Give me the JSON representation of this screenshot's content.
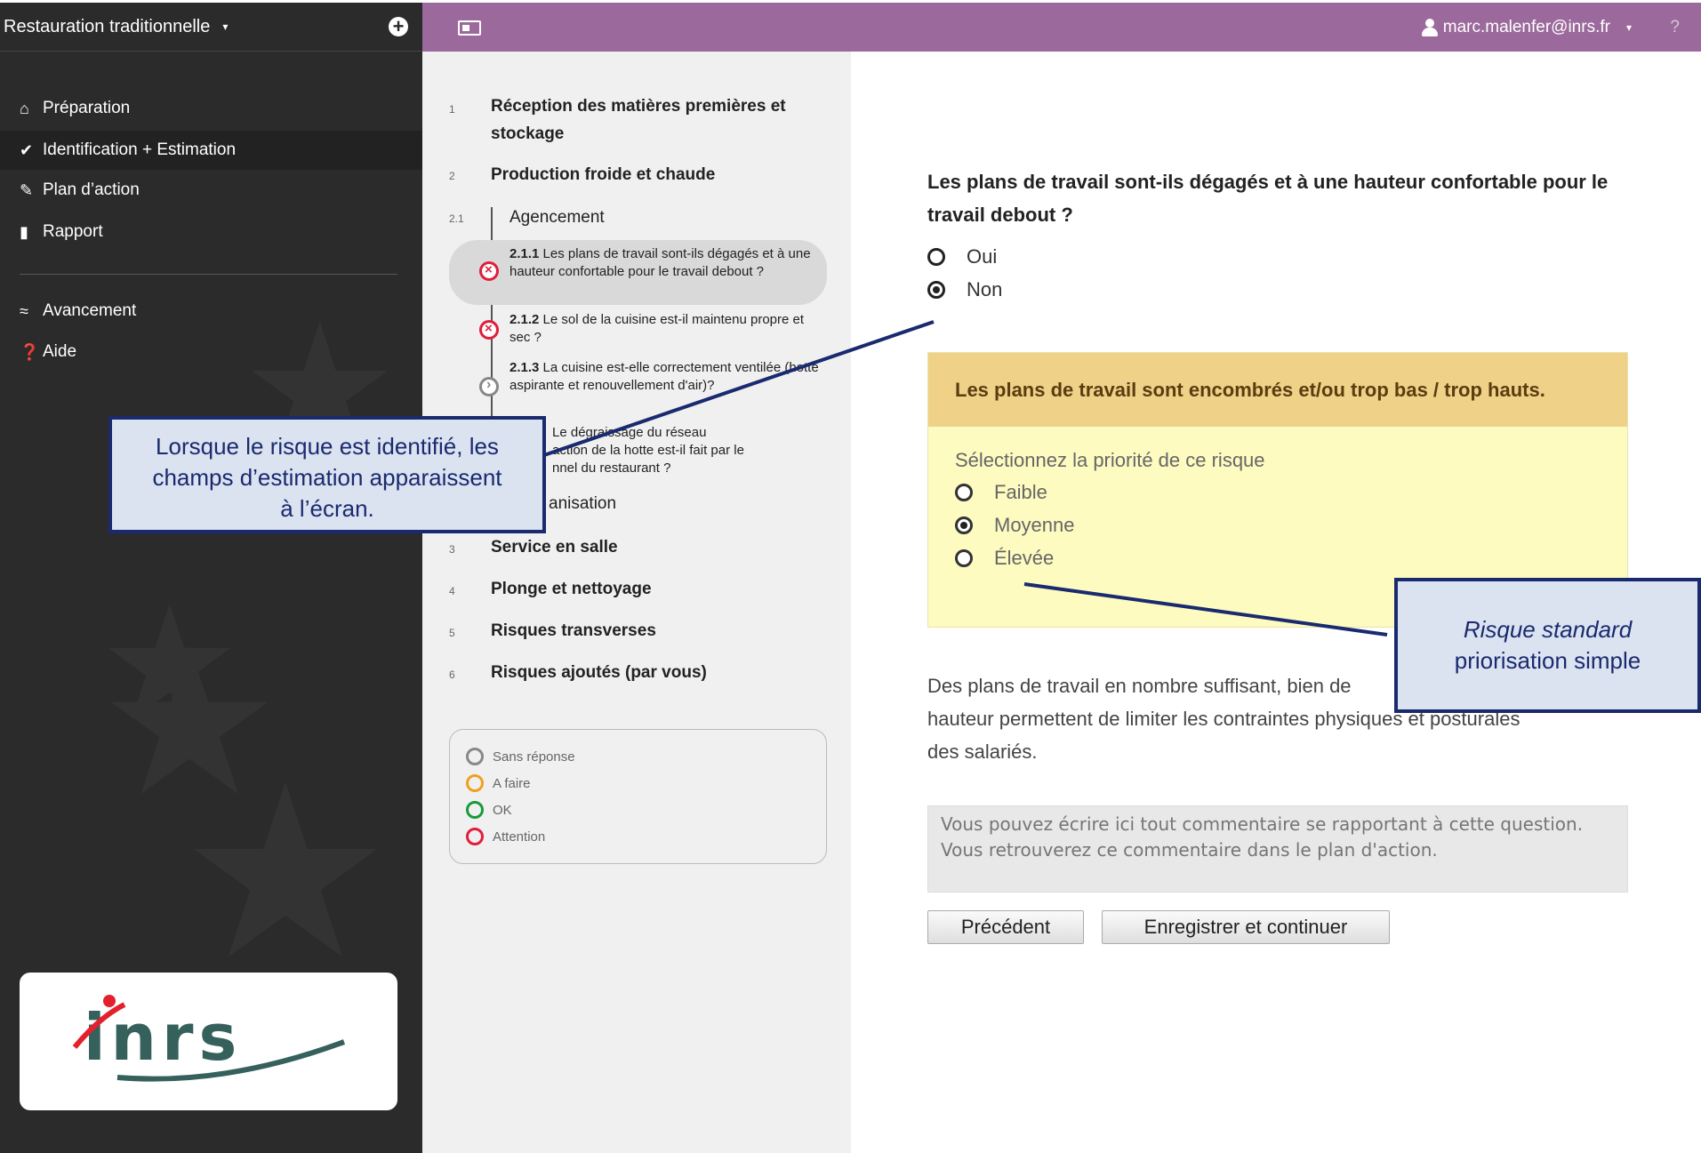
{
  "topbar": {
    "workspace_title": "Restauration traditionnelle",
    "workspace_caret": "▾",
    "add_label": "+",
    "user_email": "marc.malenfer@inrs.fr",
    "user_caret": "▾",
    "help_label": "?"
  },
  "sidebar": {
    "items": [
      {
        "label": "Préparation",
        "icon": "home-icon"
      },
      {
        "label": "Identification + Estimation",
        "icon": "check-circle-icon"
      },
      {
        "label": "Plan d’action",
        "icon": "pencil-icon"
      },
      {
        "label": "Rapport",
        "icon": "file-icon"
      },
      {
        "label": "Avancement",
        "icon": "chart-line-icon"
      },
      {
        "label": "Aide",
        "icon": "question-circle-icon"
      }
    ],
    "logo_text": "inrs"
  },
  "tree": {
    "sections": [
      {
        "num": "1",
        "label": "Réception des matières premières et stockage"
      },
      {
        "num": "2",
        "label": "Production froide et chaude"
      },
      {
        "num": "3",
        "label": "Service en salle"
      },
      {
        "num": "4",
        "label": "Plonge et nettoyage"
      },
      {
        "num": "5",
        "label": "Risques transverses"
      },
      {
        "num": "6",
        "label": "Risques ajoutés (par vous)"
      }
    ],
    "subsection": {
      "num": "2.1",
      "label": "Agencement"
    },
    "subsection2_label": "anisation",
    "questions": [
      {
        "code": "2.1.1",
        "text": "Les plans de travail sont-ils dégagés et à une hauteur confortable pour le travail debout ?"
      },
      {
        "code": "2.1.2",
        "text": "Le sol de la cuisine est-il maintenu propre et sec ?"
      },
      {
        "code": "2.1.3",
        "text": "La cuisine est-elle correctement ventilée (hotte aspirante et renouvellement d'air)?"
      },
      {
        "code": "",
        "text": "Le dégraissage du réseau"
      },
      {
        "code": "",
        "text": "action de la hotte est-il fait par le"
      },
      {
        "code": "",
        "text": "nnel du restaurant ?"
      }
    ],
    "legend": [
      {
        "label": "Sans réponse",
        "color": "#888888"
      },
      {
        "label": "A faire",
        "color": "#f0a020"
      },
      {
        "label": "OK",
        "color": "#1a9a3a"
      },
      {
        "label": "Attention",
        "color": "#e01e3c"
      }
    ]
  },
  "main": {
    "question": "Les plans de travail sont-ils dégagés et à une hauteur confortable pour le travail debout ?",
    "answers": [
      {
        "label": "Oui",
        "checked": false
      },
      {
        "label": "Non",
        "checked": true
      }
    ],
    "risk_title": "Les plans de travail sont encombrés et/ou trop bas / trop hauts.",
    "priority_label": "Sélectionnez la priorité de ce risque",
    "priorities": [
      {
        "label": "Faible",
        "checked": false
      },
      {
        "label": "Moyenne",
        "checked": true
      },
      {
        "label": "Élevée",
        "checked": false
      }
    ],
    "description": "Des plans de travail en nombre suffisant, bien de hauteur permettent de limiter les contraintes physiques et posturales des salariés.",
    "description_line1": "Des plans de travail en nombre suffisant, bien de",
    "description_line2": "hauteur permettent de limiter les contraintes physiques et posturales",
    "description_line3": "des salariés.",
    "comment_placeholder": "Vous pouvez écrire ici tout commentaire se rapportant à cette question. Vous retrouverez ce commentaire dans le plan d'action.",
    "prev_button": "Précédent",
    "save_button": "Enregistrer et continuer"
  },
  "callouts": {
    "left_line1": "Lorsque le risque est identifié, les",
    "left_line2": "champs d’estimation apparaissent",
    "left_line3": "à l’écran.",
    "right_line1": "Risque standard",
    "right_line2": "priorisation simple"
  },
  "colors": {
    "topbar_accent": "#9b699b",
    "sidebar_bg": "#2b2b2b",
    "risk_header": "#f0d188",
    "risk_body": "#fdfbc0",
    "callout_border": "#1a2a6e",
    "callout_bg": "#dbe3f1"
  }
}
